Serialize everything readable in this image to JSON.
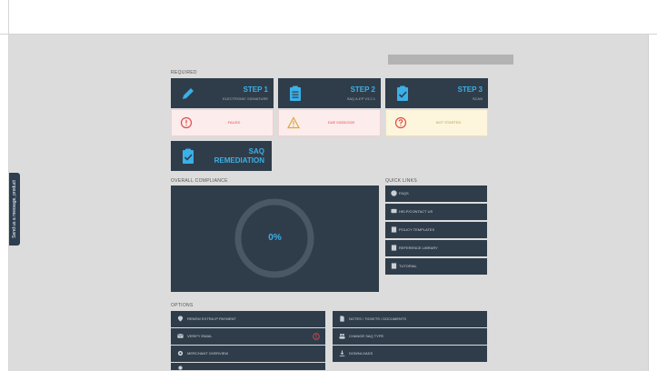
{
  "sections": {
    "required": "REQUIRED",
    "overall_compliance": "OVERALL COMPLIANCE",
    "quick_links": "QUICK LINKS",
    "options": "OPTIONS"
  },
  "steps": [
    {
      "title": "STEP 1",
      "subtitle": "ELECTRONIC SIGNATURE",
      "status": "FAILED",
      "status_color": "#e34a4a",
      "icon": "pencil-icon"
    },
    {
      "title": "STEP 2",
      "subtitle": "SAQ A-EP V3.2.1",
      "status": "DUE 03/03/2020",
      "status_color": "#e34a4a",
      "icon": "clipboard-list-icon"
    },
    {
      "title": "STEP 3",
      "subtitle": "SCAN",
      "status": "NOT STARTED",
      "status_color": "#d9a93a",
      "icon": "clipboard-check-icon"
    }
  ],
  "saq_remediation": {
    "line1": "SAQ",
    "line2": "REMEDIATION",
    "icon": "clipboard-check-icon"
  },
  "compliance": {
    "percent_label": "0%",
    "percent": 0
  },
  "quick_links": [
    {
      "label": "FAQS",
      "icon": "question-circle-icon"
    },
    {
      "label": "HELP/CONTACT US",
      "icon": "chat-icon"
    },
    {
      "label": "POLICY TEMPLATES",
      "icon": "document-icon"
    },
    {
      "label": "REFERENCE LIBRARY",
      "icon": "book-icon"
    },
    {
      "label": "TUTORIAL",
      "icon": "play-icon"
    }
  ],
  "options_left": [
    {
      "label": "RENEW EXTRA IP PAYMENT",
      "icon": "location-icon"
    },
    {
      "label": "VERIFY EMAIL",
      "icon": "envelope-icon",
      "alert": true
    },
    {
      "label": "MERCHANT OVERVIEW",
      "icon": "gear-icon"
    },
    {
      "label": "",
      "icon": "more-icon"
    }
  ],
  "options_right": [
    {
      "label": "NOTES / TICKETS / DOCUMENTS",
      "icon": "file-icon"
    },
    {
      "label": "CHANGE SAQ TYPE",
      "icon": "users-icon"
    },
    {
      "label": "DOWNLOADS",
      "icon": "download-icon"
    }
  ],
  "feedback_tab": "Send us a message, product",
  "colors": {
    "panel": "#2f3d4a",
    "accent": "#3bb0e8",
    "background": "#dcdcdc"
  }
}
